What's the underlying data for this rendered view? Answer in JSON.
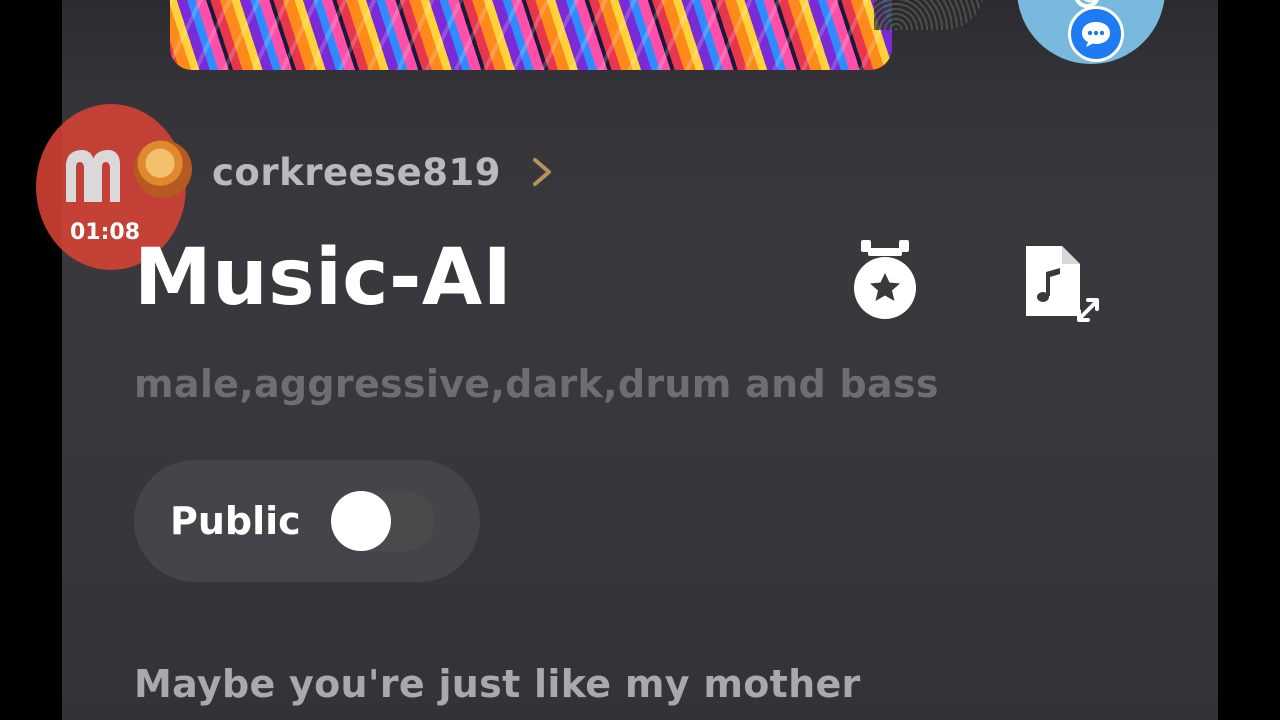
{
  "creator": {
    "username": "corkreese819"
  },
  "song": {
    "title": "Music-AI",
    "tags": "male,aggressive,dark,drum and bass",
    "lyrics_preview": "Maybe you're just like my mother"
  },
  "visibility": {
    "label": "Public",
    "enabled": false
  },
  "recorder": {
    "time": "01:08"
  },
  "icons": {
    "award": "award-medal-icon",
    "file": "music-file-expand-icon",
    "chat": "chat-bubble-icon",
    "chevron": "chevron-right-icon"
  },
  "colors": {
    "background": "#37373c",
    "accent_bubble": "#1f7bf2",
    "recorder": "#d64234",
    "tags_text": "#6e6e72"
  }
}
